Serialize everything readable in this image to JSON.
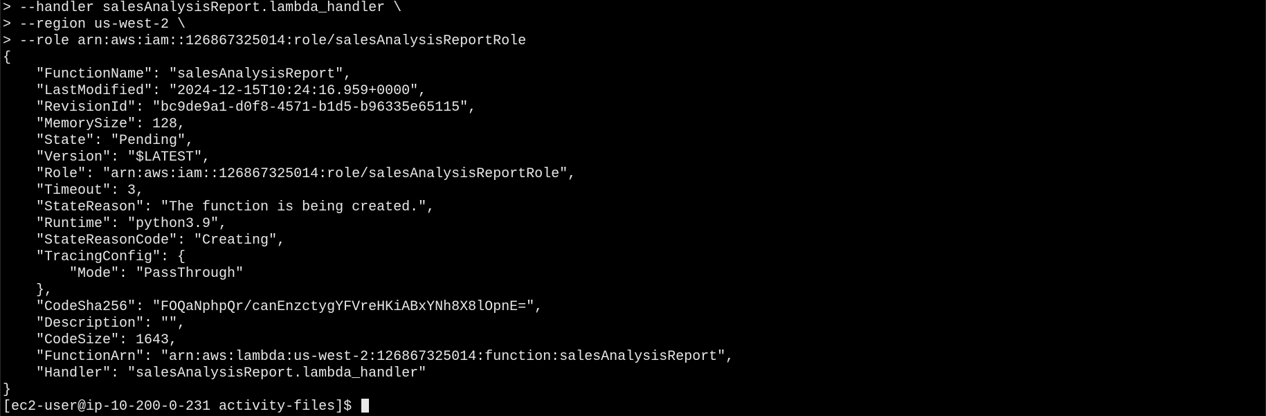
{
  "terminal": {
    "colors": {
      "background": "#000000",
      "foreground": "#e8e8e8"
    },
    "lines": [
      "> --handler salesAnalysisReport.lambda_handler \\",
      "> --region us-west-2 \\",
      "> --role arn:aws:iam::126867325014:role/salesAnalysisReportRole",
      "{",
      "    \"FunctionName\": \"salesAnalysisReport\",",
      "    \"LastModified\": \"2024-12-15T10:24:16.959+0000\",",
      "    \"RevisionId\": \"bc9de9a1-d0f8-4571-b1d5-b96335e65115\",",
      "    \"MemorySize\": 128,",
      "    \"State\": \"Pending\",",
      "    \"Version\": \"$LATEST\",",
      "    \"Role\": \"arn:aws:iam::126867325014:role/salesAnalysisReportRole\",",
      "    \"Timeout\": 3,",
      "    \"StateReason\": \"The function is being created.\",",
      "    \"Runtime\": \"python3.9\",",
      "    \"StateReasonCode\": \"Creating\",",
      "    \"TracingConfig\": {",
      "        \"Mode\": \"PassThrough\"",
      "    },",
      "    \"CodeSha256\": \"FOQaNphpQr/canEnzctygYFVreHKiABxYNh8X8lOpnE=\",",
      "    \"Description\": \"\",",
      "    \"CodeSize\": 1643,",
      "    \"FunctionArn\": \"arn:aws:lambda:us-west-2:126867325014:function:salesAnalysisReport\",",
      "    \"Handler\": \"salesAnalysisReport.lambda_handler\"",
      "}"
    ],
    "prompt": "[ec2-user@ip-10-200-0-231 activity-files]$ "
  }
}
